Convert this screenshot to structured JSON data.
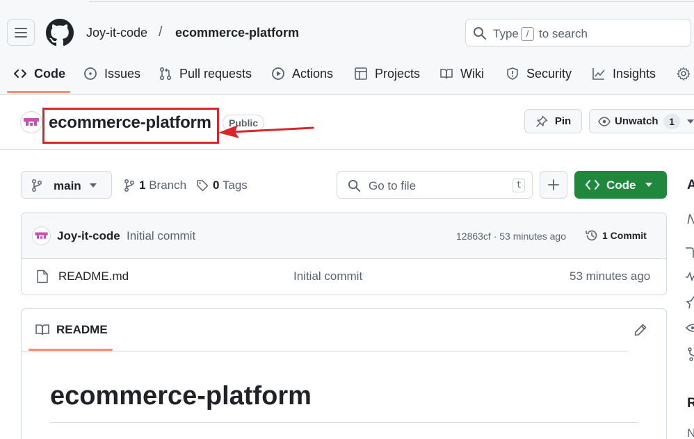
{
  "header": {
    "owner": "Joy-it-code",
    "separator": "/",
    "repo": "ecommerce-platform",
    "search": {
      "prefix": "Type",
      "key": "/",
      "suffix": "to search"
    }
  },
  "tabs": [
    {
      "label": "Code",
      "icon": "code-icon",
      "active": true
    },
    {
      "label": "Issues",
      "icon": "issue-icon"
    },
    {
      "label": "Pull requests",
      "icon": "pull-request-icon"
    },
    {
      "label": "Actions",
      "icon": "play-icon"
    },
    {
      "label": "Projects",
      "icon": "table-icon"
    },
    {
      "label": "Wiki",
      "icon": "book-icon"
    },
    {
      "label": "Security",
      "icon": "shield-icon"
    },
    {
      "label": "Insights",
      "icon": "graph-icon"
    },
    {
      "label": "",
      "icon": "gear-icon"
    }
  ],
  "repo": {
    "name": "ecommerce-platform",
    "visibility": "Public",
    "pin_label": "Pin",
    "watch_label": "Unwatch",
    "watch_count": "1"
  },
  "toolbar": {
    "branch": "main",
    "branch_count": "1",
    "branch_word": "Branch",
    "tag_count": "0",
    "tag_word": "Tags",
    "goto_placeholder": "Go to file",
    "goto_key": "t",
    "code_label": "Code"
  },
  "latest_commit": {
    "author": "Joy-it-code",
    "message": "Initial commit",
    "meta": "12863cf · 53 minutes ago",
    "count_label": "1 Commit"
  },
  "files": [
    {
      "name": "README.md",
      "commit": "Initial commit",
      "age": "53 minutes ago"
    }
  ],
  "readme": {
    "tab_label": "README",
    "heading": "ecommerce-platform"
  },
  "sidebar": {
    "about": "A",
    "desc": "N",
    "releases": "R",
    "no_releases": "N"
  },
  "colors": {
    "accent_underline": "#fd8c73",
    "code_button": "#1f883d",
    "highlight": "#d9262c",
    "border": "#d1d9e0"
  }
}
